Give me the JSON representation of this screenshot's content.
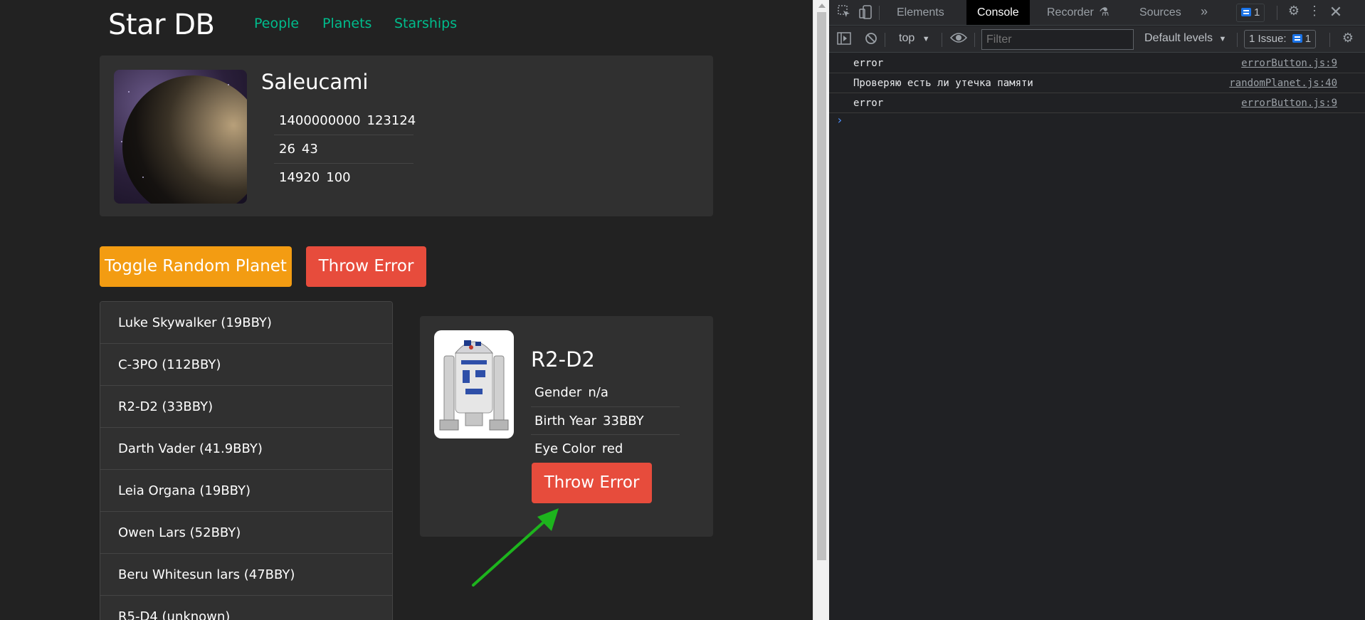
{
  "app": {
    "brand": "Star DB",
    "nav": [
      "People",
      "Planets",
      "Starships"
    ]
  },
  "random_planet": {
    "name": "Saleucami",
    "rows": [
      [
        "1400000000",
        "123124"
      ],
      [
        "26",
        "43"
      ],
      [
        "14920",
        "100"
      ]
    ]
  },
  "buttons": {
    "toggle_random_planet": "Toggle Random Planet",
    "throw_error": "Throw Error"
  },
  "people_list": [
    "Luke Skywalker (19BBY)",
    "C-3PO (112BBY)",
    "R2-D2 (33BBY)",
    "Darth Vader (41.9BBY)",
    "Leia Organa (19BBY)",
    "Owen Lars (52BBY)",
    "Beru Whitesun lars (47BBY)",
    "R5-D4 (unknown)"
  ],
  "person_details": {
    "name": "R2-D2",
    "fields": [
      {
        "label": "Gender",
        "value": "n/a"
      },
      {
        "label": "Birth Year",
        "value": "33BBY"
      },
      {
        "label": "Eye Color",
        "value": "red"
      }
    ],
    "button": "Throw Error"
  },
  "devtools": {
    "tabs": [
      "Elements",
      "Console",
      "Recorder",
      "Sources"
    ],
    "active_tab": "Console",
    "message_badge": "1",
    "context": "top",
    "filter_placeholder": "Filter",
    "levels": "Default levels",
    "issues": "1 Issue:",
    "issues_count": "1",
    "logs": [
      {
        "text": "error",
        "source": "errorButton.js:9"
      },
      {
        "text": "Проверяю есть ли утечка памяти",
        "source": "randomPlanet.js:40"
      },
      {
        "text": "error",
        "source": "errorButton.js:9"
      }
    ],
    "prompt": "›"
  },
  "colors": {
    "background": "#222222",
    "panel": "#303030",
    "link": "#00bc8c",
    "warning": "#f39c12",
    "danger": "#e74c3c",
    "annotation_arrow": "#1db41d",
    "devtools_bg": "#202124"
  }
}
